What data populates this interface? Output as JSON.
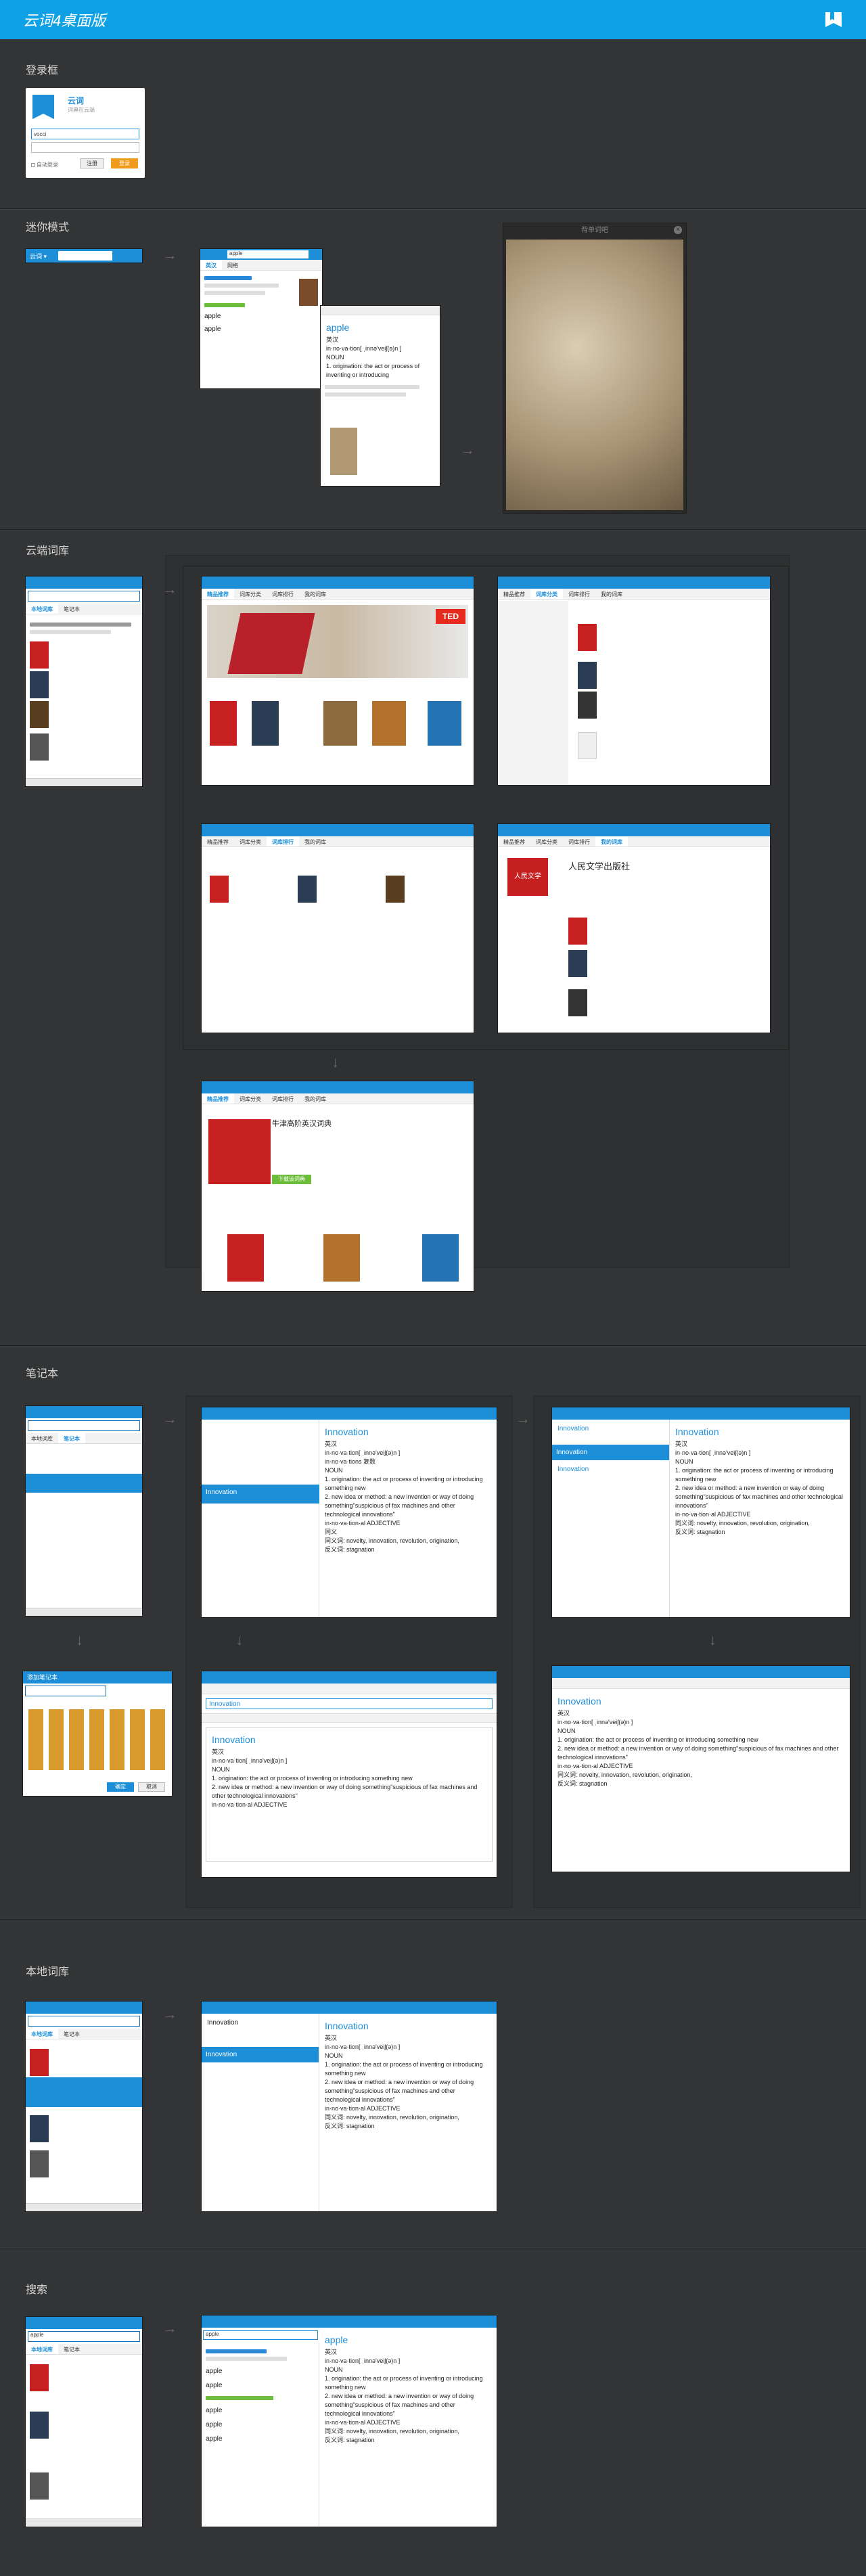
{
  "header": {
    "title": "云词4桌面版"
  },
  "sections": {
    "login": "登录框",
    "mini": "迷你模式",
    "cloud": "云端词库",
    "notebook": "笔记本",
    "local": "本地词库",
    "search": "搜索"
  },
  "login_window": {
    "brand": "云词",
    "slogan": "词典在云端",
    "username_value": "vocci",
    "remember_label": "自动登录",
    "register_label": "注册",
    "login_label": "登录"
  },
  "mini_mode": {
    "app_name": "云词 ▾",
    "search_value": "apple",
    "popup_word": "apple",
    "photo_caption": "背单词吧",
    "def_head": "英汉",
    "phonetic": "in·no·va·tion[ ˌinnəʹveiʃ(ə)n ]",
    "noun_label": "NOUN",
    "def1": "1. origination: the act or process of inventing or introducing",
    "list_word": "apple"
  },
  "cloud_library": {
    "tabs": [
      "精品推荐",
      "词库分类",
      "词库排行",
      "我的词库"
    ],
    "book_title": "牛津高阶英汉词典",
    "publisher": "人民文学出版社",
    "publisher_logo": "人民文学",
    "banner_text": "TED",
    "download_label": "下载该词典"
  },
  "notebook": {
    "word": "Innovation",
    "title": "Innovation",
    "def_head": "英汉",
    "phonetic": "in·no·va·tion[ ˌinnəʹveiʃ(ə)n ]",
    "phonetic2": "in·no·va·tions 复数",
    "noun": "NOUN",
    "def1": "1. origination: the act or process of inventing or introducing something new",
    "def2": "2. new idea or method: a new invention or way of doing something\"suspicious of fax machines and other technological innovations\"",
    "adj": "in·no·va·tion·al ADJECTIVE",
    "syn_head": "同义",
    "syn": "同义词: novelty, innovation, revolution, origination,",
    "ant": "反义词: stagnation",
    "create_label": "添加笔记本",
    "ok_label": "确定",
    "cancel_label": "取消"
  },
  "search_mode": {
    "query": "apple",
    "result_word": "apple"
  }
}
